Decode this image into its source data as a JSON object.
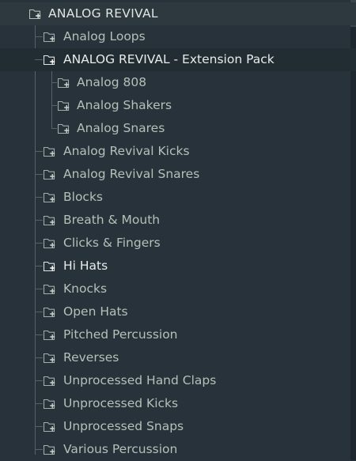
{
  "root": {
    "label": "ANALOG REVIVAL",
    "icon": "folder-add-icon"
  },
  "items": [
    {
      "label": "Analog Loops",
      "icon": "folder-add-icon"
    },
    {
      "label": "ANALOG REVIVAL - Extension Pack",
      "icon": "folder-add-icon",
      "state": "selected"
    },
    {
      "label": "Analog 808",
      "icon": "folder-add-icon",
      "level": 2
    },
    {
      "label": "Analog Shakers",
      "icon": "folder-add-icon",
      "level": 2
    },
    {
      "label": "Analog Snares",
      "icon": "folder-add-icon",
      "level": 2
    },
    {
      "label": "Analog Revival Kicks",
      "icon": "folder-add-icon"
    },
    {
      "label": "Analog Revival Snares",
      "icon": "folder-add-icon"
    },
    {
      "label": "Blocks",
      "icon": "folder-add-icon"
    },
    {
      "label": "Breath & Mouth",
      "icon": "folder-add-icon"
    },
    {
      "label": "Clicks & Fingers",
      "icon": "folder-add-icon"
    },
    {
      "label": "Hi Hats",
      "icon": "folder-add-icon",
      "state": "hover"
    },
    {
      "label": "Knocks",
      "icon": "folder-add-icon"
    },
    {
      "label": "Open Hats",
      "icon": "folder-add-icon"
    },
    {
      "label": "Pitched Percussion",
      "icon": "folder-add-icon"
    },
    {
      "label": "Reverses",
      "icon": "folder-add-icon"
    },
    {
      "label": "Unprocessed Hand Claps",
      "icon": "folder-add-icon"
    },
    {
      "label": "Unprocessed Kicks",
      "icon": "folder-add-icon"
    },
    {
      "label": "Unprocessed Snaps",
      "icon": "folder-add-icon"
    },
    {
      "label": "Various Percussion",
      "icon": "folder-add-icon"
    }
  ],
  "colors": {
    "background": "#27323a",
    "root_row": "#2d383f",
    "selected_row": "#222c33",
    "text": "#b3c1b9",
    "text_bright": "#e7ecea",
    "tree_line": "#56636a"
  }
}
